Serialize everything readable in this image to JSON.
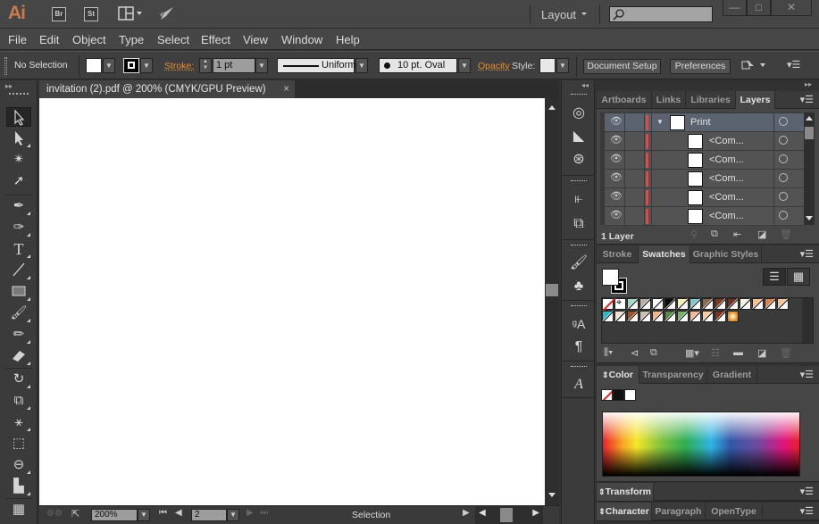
{
  "app": {
    "logo": "Ai",
    "bridge": "Br",
    "stock": "St",
    "workspace": "Layout",
    "search_placeholder": ""
  },
  "window_controls": {
    "minimize": "—",
    "maximize": "□",
    "close": "✕"
  },
  "menu": [
    "File",
    "Edit",
    "Object",
    "Type",
    "Select",
    "Effect",
    "View",
    "Window",
    "Help"
  ],
  "control_bar": {
    "selection_label": "No Selection",
    "fill_color": "#ffffff",
    "stroke_label": "Stroke:",
    "stroke_weight": "1 pt",
    "stroke_profile": "Uniform",
    "brush": "10 pt. Oval",
    "opacity_label": "Opacity",
    "style_label": "Style:",
    "document_setup": "Document Setup",
    "preferences": "Preferences"
  },
  "document": {
    "tab_title": "invitation (2).pdf @ 200% (CMYK/GPU Preview)",
    "close": "×"
  },
  "tools": [
    "selection-tool",
    "direct-selection-tool",
    "magic-wand-tool",
    "lasso-tool",
    "pen-tool",
    "curvature-tool",
    "type-tool",
    "line-tool",
    "rectangle-tool",
    "paintbrush-tool",
    "pencil-tool",
    "eraser-tool",
    "rotate-tool",
    "scale-tool",
    "puppet-warp-tool",
    "free-transform-tool",
    "shape-builder-tool",
    "perspective-grid-tool",
    "mesh-tool"
  ],
  "status_bar": {
    "zoom": "200%",
    "artboard": "2",
    "status": "Selection"
  },
  "layers_panel": {
    "tabs": [
      "Artboards",
      "Links",
      "Libraries",
      "Layers"
    ],
    "active_tab": "Layers",
    "layers": [
      {
        "name": "Print",
        "expanded": true
      },
      {
        "name": "<Com..."
      },
      {
        "name": "<Com..."
      },
      {
        "name": "<Com..."
      },
      {
        "name": "<Com..."
      },
      {
        "name": "<Com..."
      }
    ],
    "footer": "1 Layer",
    "layer_color": "#e34646"
  },
  "swatches_panel": {
    "tabs": [
      "Stroke",
      "Swatches",
      "Graphic Styles"
    ],
    "active_tab": "Swatches",
    "swatches": [
      "none",
      "registration",
      "#9fd8cc",
      "#b8b0a6",
      "#ffffff",
      "#0a0a0a",
      "#f6f1b8",
      "#7ec9cb",
      "#8a6a55",
      "#7a3a20",
      "#6e3020",
      "#fbf7ec",
      "#f7bf8e",
      "#d9844f",
      "#f9c59a",
      "#2fb8c4",
      "#efe1d4",
      "#a0522d",
      "#c9c0b0",
      "#f4b48c",
      "#5a8a4a",
      "#7ab06a",
      "#f5b898",
      "#f8c8a0",
      "#7a3420",
      "gradient-gold"
    ]
  },
  "color_panel": {
    "tabs": [
      "Color",
      "Transparency",
      "Gradient"
    ],
    "active_tab": "Color"
  },
  "transform_panel": {
    "title": "Transform"
  },
  "character_panel": {
    "tabs": [
      "Character",
      "Paragraph",
      "OpenType"
    ],
    "active_tab": "Character"
  }
}
